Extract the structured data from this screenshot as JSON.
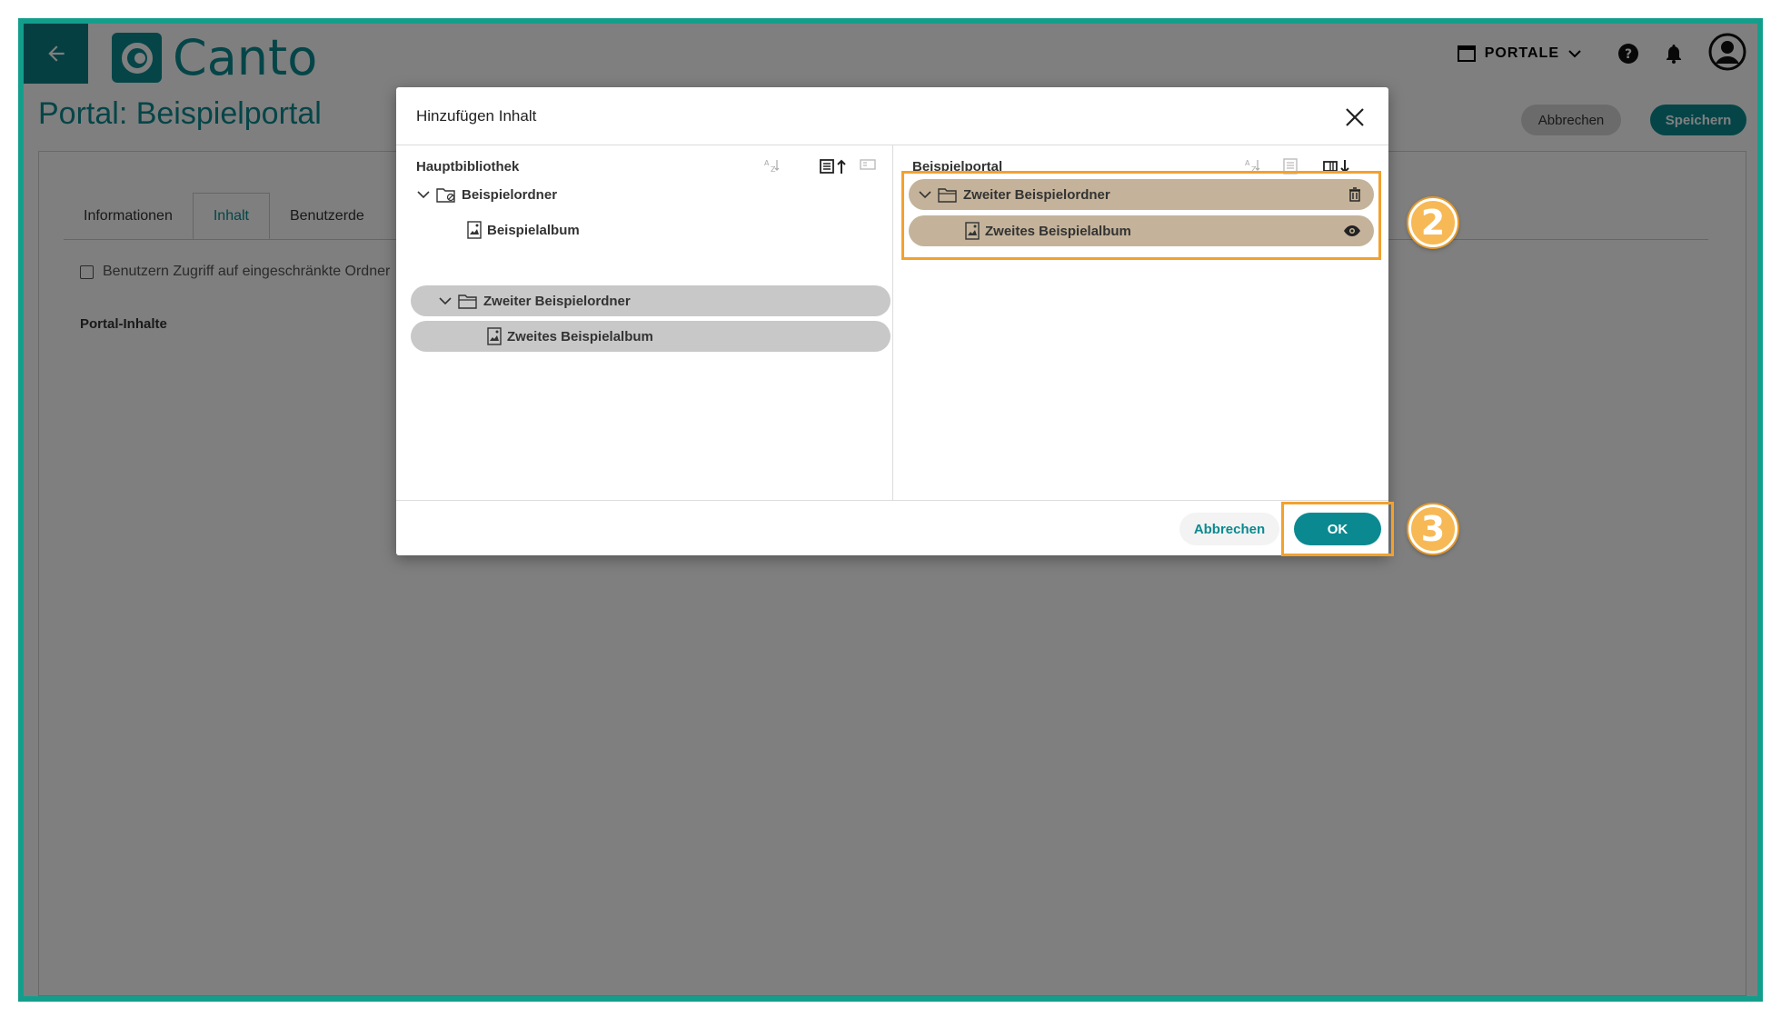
{
  "app": {
    "logo_text": "Canto",
    "portale_label": "PORTALE",
    "page_title": "Portal: Beispielportal",
    "cancel_label": "Abbrechen",
    "save_label": "Speichern",
    "tabs": [
      {
        "label": "Informationen"
      },
      {
        "label": "Inhalt"
      },
      {
        "label": "Benutzerde"
      }
    ],
    "checkbox_label": "Benutzern Zugriff auf eingeschränkte Ordner",
    "section_label": "Portal-Inhalte"
  },
  "dialog": {
    "title": "Hinzufügen Inhalt",
    "left_pane": {
      "title": "Hauptbibliothek",
      "items": [
        {
          "label": "Beispielordner",
          "type": "folder"
        },
        {
          "label": "Beispielalbum",
          "type": "album"
        },
        {
          "label": "Zweiter Beispielordner",
          "type": "folder"
        },
        {
          "label": "Zweites Beispielalbum",
          "type": "album"
        }
      ]
    },
    "right_pane": {
      "title": "Beispielportal",
      "items": [
        {
          "label": "Zweiter Beispielordner",
          "type": "folder"
        },
        {
          "label": "Zweites Beispielalbum",
          "type": "album"
        }
      ]
    },
    "cancel_label": "Abbrechen",
    "ok_label": "OK"
  },
  "annotations": {
    "step_2": "2",
    "step_3": "3"
  },
  "colors": {
    "brand": "#0a8a90",
    "frame": "#139e8c",
    "highlight": "#f2a12e"
  }
}
